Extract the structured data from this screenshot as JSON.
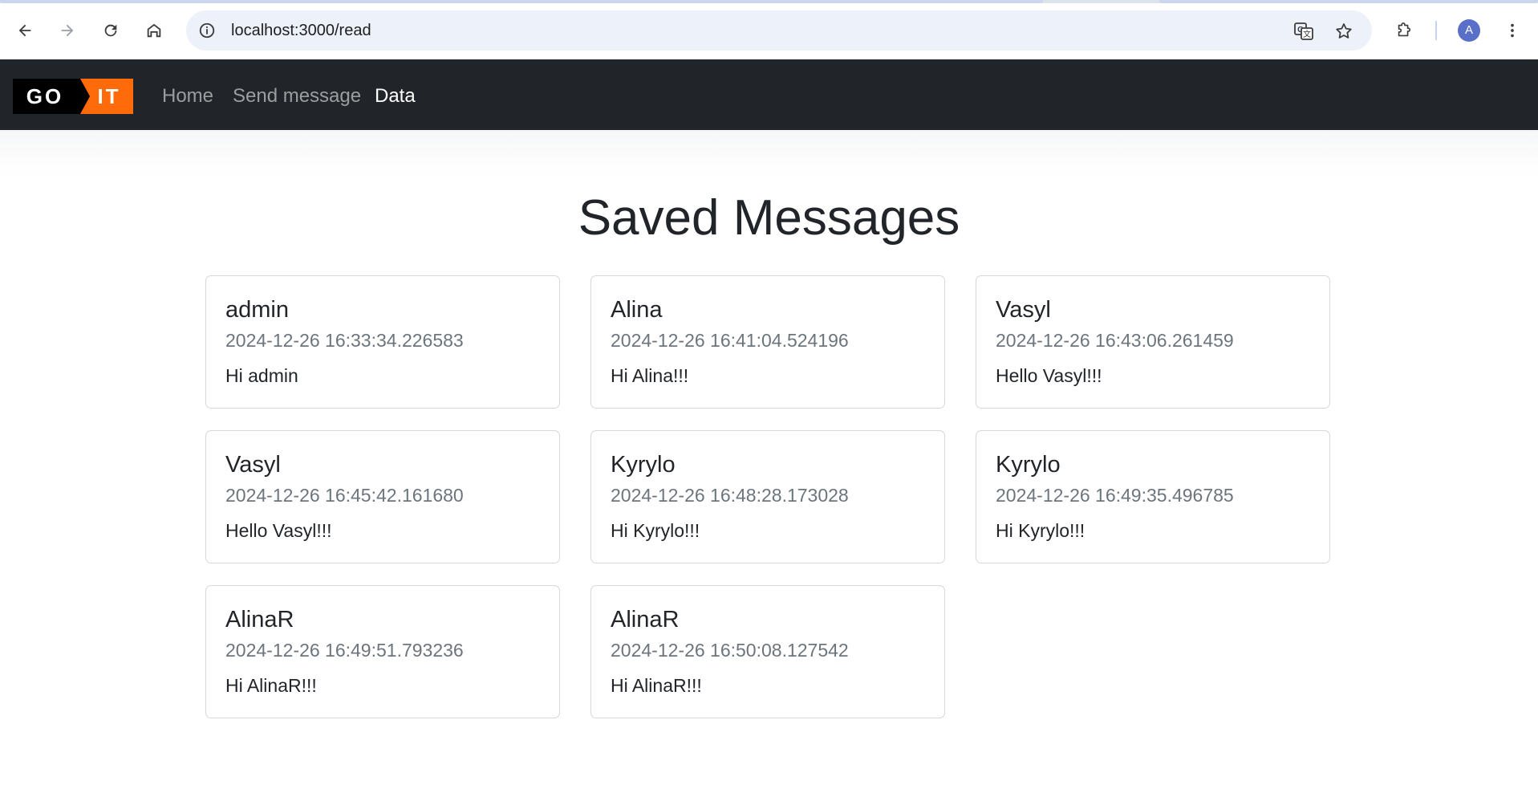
{
  "browser": {
    "url": "localhost:3000/read",
    "profile_initial": "A"
  },
  "navbar": {
    "logo_text_left": "GO",
    "logo_text_right": "IT",
    "links": [
      {
        "label": "Home",
        "active": false
      },
      {
        "label": "Send message",
        "active": false
      },
      {
        "label": "Data",
        "active": true
      }
    ],
    "colors": {
      "background": "#212529",
      "logo_accent": "#ff6b0a"
    }
  },
  "main": {
    "title": "Saved Messages",
    "messages": [
      {
        "username": "admin",
        "timestamp": "2024-12-26 16:33:34.226583",
        "text": "Hi admin"
      },
      {
        "username": "Alina",
        "timestamp": "2024-12-26 16:41:04.524196",
        "text": "Hi Alina!!!"
      },
      {
        "username": "Vasyl",
        "timestamp": "2024-12-26 16:43:06.261459",
        "text": "Hello Vasyl!!!"
      },
      {
        "username": "Vasyl",
        "timestamp": "2024-12-26 16:45:42.161680",
        "text": "Hello Vasyl!!!"
      },
      {
        "username": "Kyrylo",
        "timestamp": "2024-12-26 16:48:28.173028",
        "text": "Hi Kyrylo!!!"
      },
      {
        "username": "Kyrylo",
        "timestamp": "2024-12-26 16:49:35.496785",
        "text": "Hi Kyrylo!!!"
      },
      {
        "username": "AlinaR",
        "timestamp": "2024-12-26 16:49:51.793236",
        "text": "Hi AlinaR!!!"
      },
      {
        "username": "AlinaR",
        "timestamp": "2024-12-26 16:50:08.127542",
        "text": "Hi AlinaR!!!"
      }
    ]
  },
  "icons": [
    "back-arrow-icon",
    "forward-arrow-icon",
    "reload-icon",
    "home-icon",
    "site-info-icon",
    "translate-icon",
    "bookmark-star-icon",
    "extensions-icon",
    "more-menu-icon"
  ]
}
